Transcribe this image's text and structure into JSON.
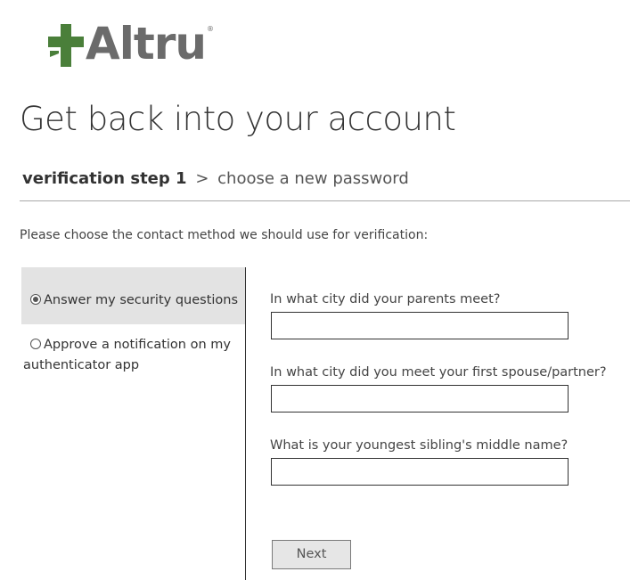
{
  "brand": {
    "logo_text": "Altru",
    "logo_registered": "®",
    "logo_color": "#4a7f3a",
    "text_color": "#6b6b6b"
  },
  "page": {
    "title": "Get back into your account"
  },
  "steps": {
    "current": "verification step 1",
    "separator": ">",
    "next": "choose a new password"
  },
  "instructions": "Please choose the contact method we should use for verification:",
  "methods": [
    {
      "label": "Answer my security questions",
      "selected": true
    },
    {
      "label": "Approve a notification on my authenticator app",
      "selected": false
    }
  ],
  "questions": [
    {
      "label": "In what city did your parents meet?",
      "value": "",
      "placeholder": ""
    },
    {
      "label": "In what city did you meet your first spouse/partner?",
      "value": "",
      "placeholder": ""
    },
    {
      "label": "What is your youngest sibling's middle name?",
      "value": "",
      "placeholder": ""
    }
  ],
  "buttons": {
    "next_label": "Next"
  }
}
